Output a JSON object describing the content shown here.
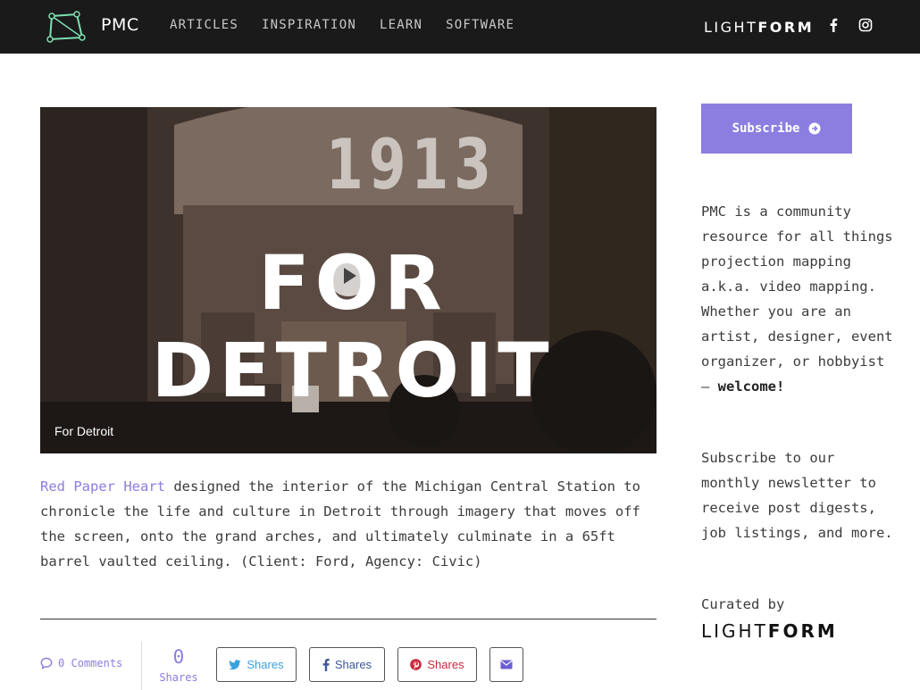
{
  "header": {
    "brand": "PMC",
    "nav": [
      "ARTICLES",
      "INSPIRATION",
      "LEARN",
      "SOFTWARE"
    ],
    "partner_logo_light": "LIGHT",
    "partner_logo_bold": "FORM",
    "social_icons": [
      "facebook-icon",
      "instagram-icon"
    ]
  },
  "hero": {
    "overlay_year": "1913",
    "overlay_title": "FOR DETROIT",
    "caption": "For Detroit",
    "play_icon": "play-icon"
  },
  "article": {
    "link_text": "Red Paper Heart",
    "body": " designed the interior of the Michigan Central Station to chronicle the life and culture in Detroit through imagery that moves off the screen, onto the grand arches, and ultimately culminate in a 65ft barrel vaulted ceiling. (Client: Ford, Agency: Civic)"
  },
  "footer": {
    "comments_count": "0",
    "comments_label": "Comments",
    "shares_count": "0",
    "shares_label": "Shares",
    "twitter_label": "Shares",
    "facebook_label": "Shares",
    "pinterest_label": "Shares"
  },
  "sidebar": {
    "subscribe_label": "Subscribe",
    "about_text": "PMC is a community resource for all things projection mapping a.k.a. video mapping. Whether you are an artist, designer, event organizer, or hobbyist – ",
    "about_bold": "welcome!",
    "newsletter_text": "Subscribe to our monthly newsletter to receive post digests, job listings, and more.",
    "curated_by": "Curated by",
    "curator_light": "LIGHT",
    "curator_bold": "FORM"
  },
  "colors": {
    "accent": "#8c7de0",
    "topbar": "#1a1a1a",
    "twitter": "#3aa1dd",
    "facebook": "#3b5998",
    "pinterest": "#c9283a"
  }
}
